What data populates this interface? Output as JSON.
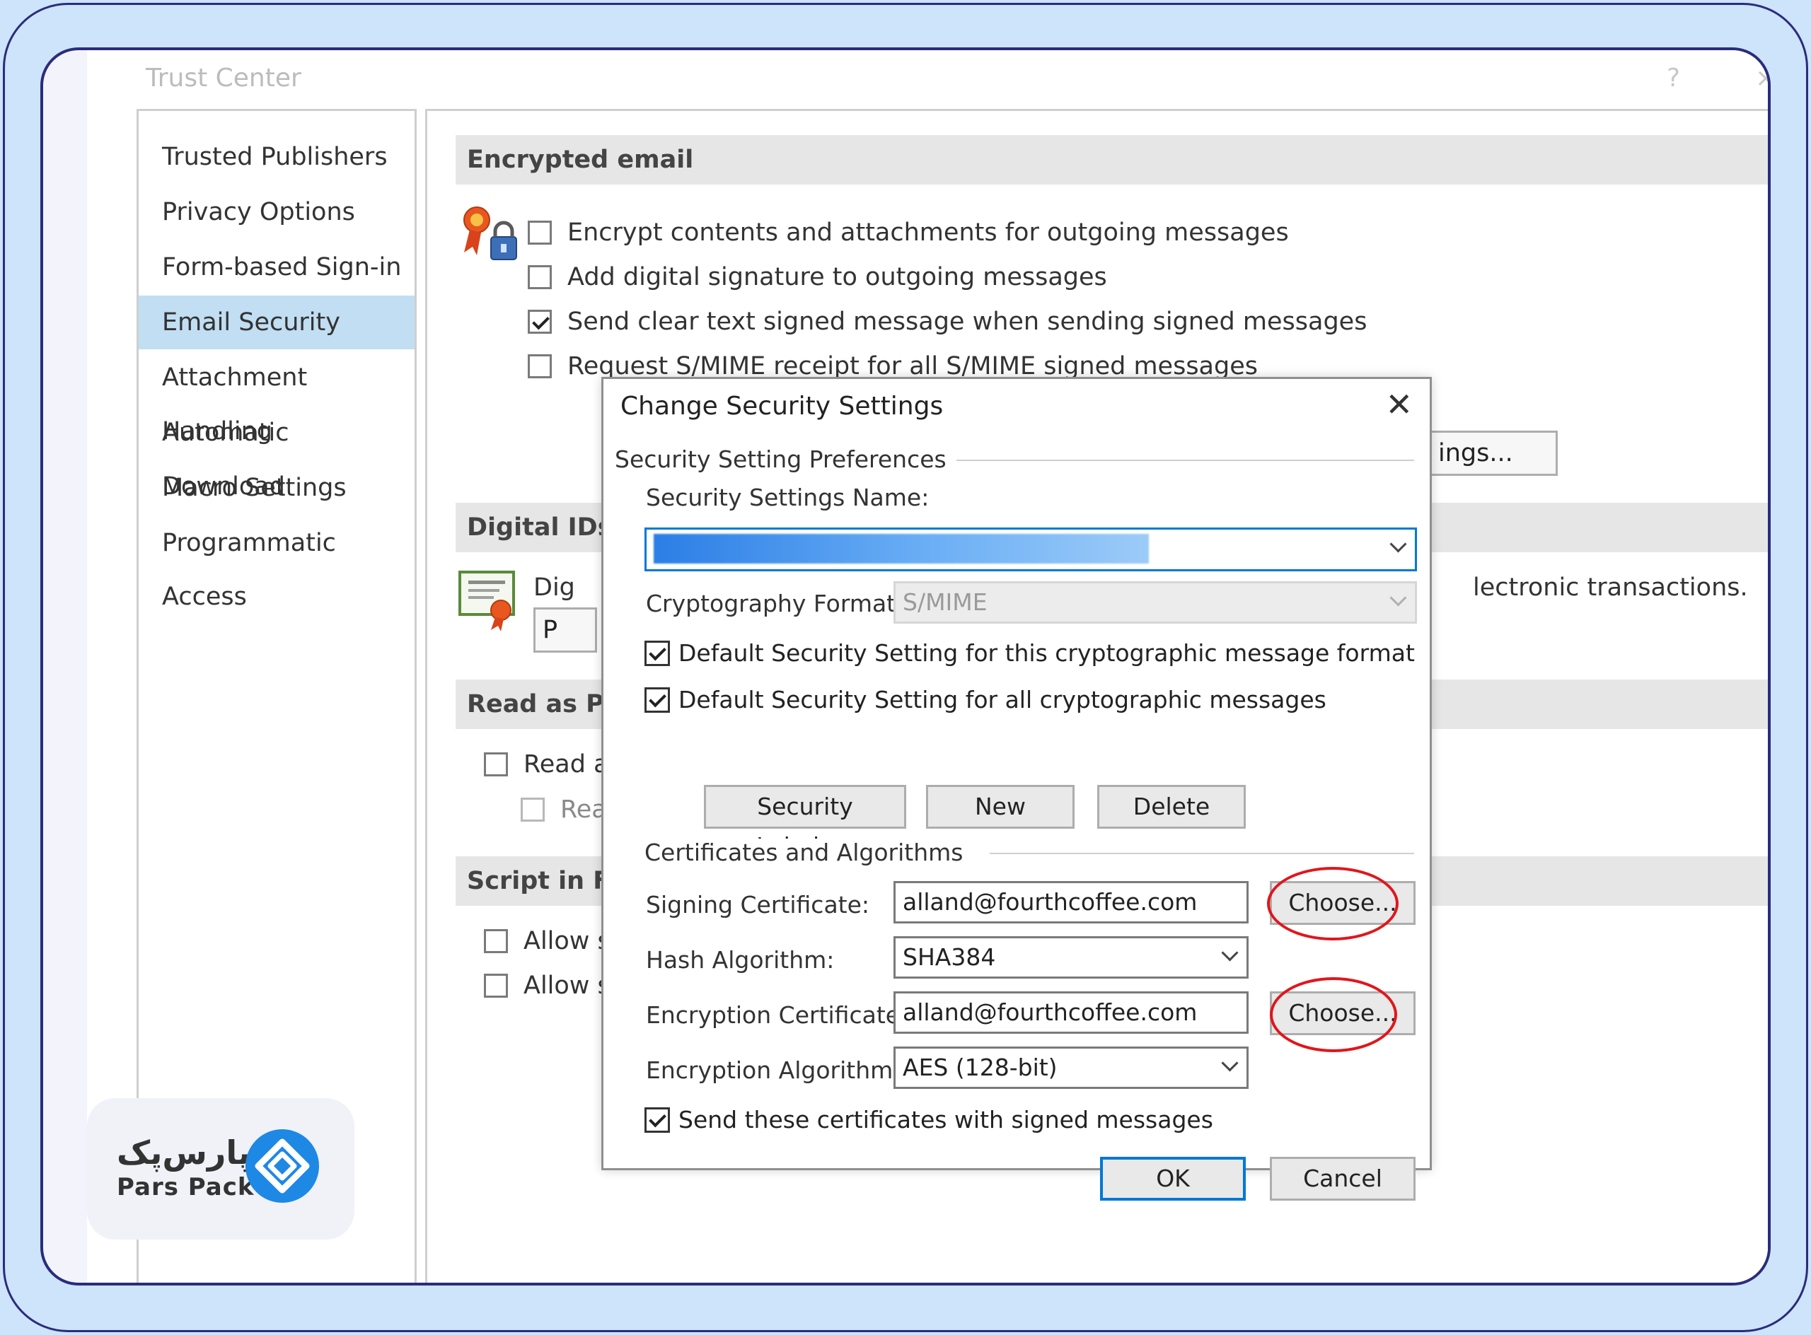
{
  "window": {
    "title": "Trust Center",
    "help_glyph": "?",
    "close_glyph": "×"
  },
  "nav": {
    "items": [
      {
        "label": "Trusted Publishers"
      },
      {
        "label": "Privacy Options"
      },
      {
        "label": "Form-based Sign-in"
      },
      {
        "label": "Email Security",
        "active": true
      },
      {
        "label": "Attachment Handling"
      },
      {
        "label": "Automatic Download"
      },
      {
        "label": "Macro Settings"
      },
      {
        "label": "Programmatic Access"
      }
    ]
  },
  "content": {
    "encrypted_email": {
      "header": "Encrypted email",
      "options": [
        {
          "label": "Encrypt contents and attachments for outgoing messages",
          "checked": false
        },
        {
          "label": "Add digital signature to outgoing messages",
          "checked": false
        },
        {
          "label": "Send clear text signed message when sending signed messages",
          "checked": true
        },
        {
          "label": "Request S/MIME receipt for all S/MIME signed messages",
          "checked": false
        }
      ],
      "settings_button_fragment": "ings..."
    },
    "digital_ids": {
      "header_fragment": "Digital IDs (",
      "text_fragment": "Dig",
      "trailing_text": "lectronic transactions.",
      "button_fragment": "P"
    },
    "read_as_plain": {
      "header_fragment": "Read as Plai",
      "option1_fragment": "Read al",
      "option2_fragment": "Rea"
    },
    "script_in_folders": {
      "header_fragment": "Script in Fol",
      "option1_fragment": "Allow s",
      "option2_fragment": "Allow s"
    }
  },
  "dialog": {
    "title": "Change Security Settings",
    "close_glyph": "✕",
    "preferences_group": "Security Setting Preferences",
    "settings_name_label": "Security Settings Name:",
    "settings_name_value": "",
    "crypto_format_label": "Cryptography Format:",
    "crypto_format_value": "S/MIME",
    "default_format_label": "Default Security Setting for this cryptographic message format",
    "default_format_checked": true,
    "default_all_label": "Default Security Setting for all cryptographic messages",
    "default_all_checked": true,
    "security_labels_button": "Security Labels...",
    "new_button": "New",
    "delete_button": "Delete",
    "certs_group": "Certificates and Algorithms",
    "signing_cert_label": "Signing Certificate:",
    "signing_cert_value": "alland@fourthcoffee.com",
    "choose_button_1": "Choose...",
    "hash_label": "Hash Algorithm:",
    "hash_value": "SHA384",
    "enc_cert_label": "Encryption Certificate:",
    "enc_cert_value": "alland@fourthcoffee.com",
    "choose_button_2": "Choose...",
    "enc_algo_label": "Encryption Algorithm:",
    "enc_algo_value": "AES (128-bit)",
    "send_certs_label": "Send these certificates with signed messages",
    "send_certs_checked": true,
    "ok_button": "OK",
    "cancel_button": "Cancel",
    "highlight_color": "#e0161c",
    "focus_color": "#0078d7"
  },
  "branding": {
    "logo_fa": "پارس‌پک",
    "logo_en": "Pars Pack",
    "badge_color": "#1e88e5"
  }
}
